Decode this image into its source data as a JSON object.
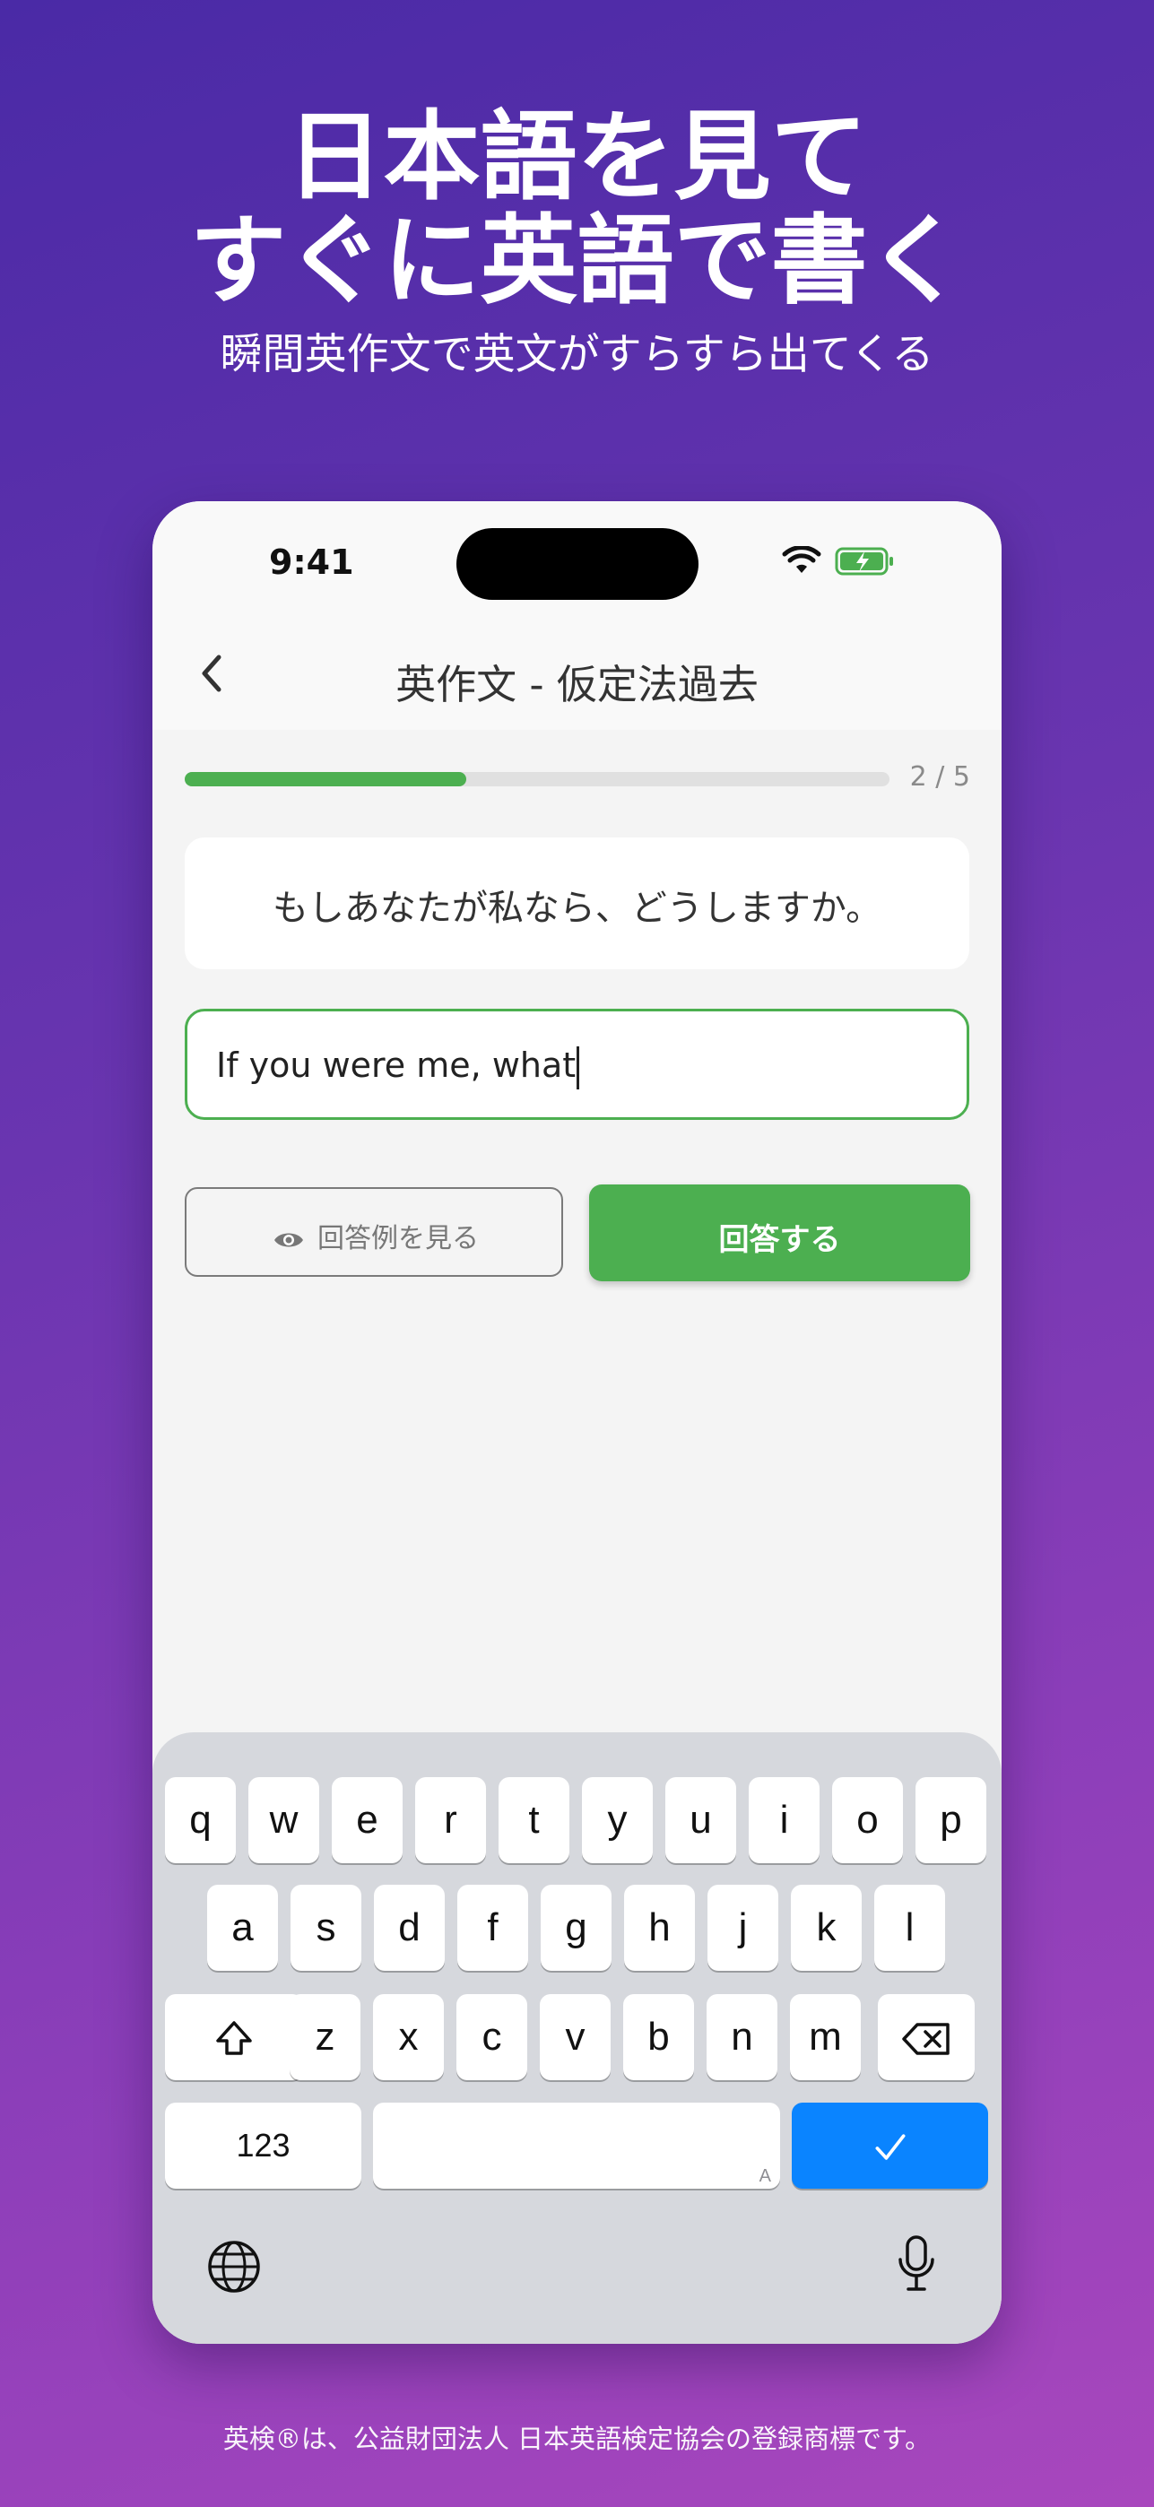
{
  "promo": {
    "headline_line1": "日本語を見て",
    "headline_line2": "すぐに英語で書く",
    "subheadline": "瞬間英作文で英文がすらすら出てくる",
    "footnote": "英検®は、公益財団法人 日本英語検定協会の登録商標です。"
  },
  "status_bar": {
    "time": "9:41",
    "icons": [
      "wifi-icon",
      "battery-charging-icon"
    ]
  },
  "nav": {
    "title": "英作文 - 仮定法過去",
    "back_icon": "chevron-left-icon"
  },
  "progress": {
    "current": 2,
    "total": 5,
    "label": "2 / 5",
    "fraction": 0.4,
    "color": "#4caf50"
  },
  "question": {
    "japanese": "もしあなたが私なら、どうしますか。"
  },
  "answer_input": {
    "value": "If you were me, what"
  },
  "buttons": {
    "show_example_label": "回答例を見る",
    "show_example_icon": "eye-icon",
    "submit_label": "回答する"
  },
  "keyboard": {
    "row1": [
      "q",
      "w",
      "e",
      "r",
      "t",
      "y",
      "u",
      "i",
      "o",
      "p"
    ],
    "row2": [
      "a",
      "s",
      "d",
      "f",
      "g",
      "h",
      "j",
      "k",
      "l"
    ],
    "row3": [
      "z",
      "x",
      "c",
      "v",
      "b",
      "n",
      "m"
    ],
    "numbers_key": "123",
    "space_hint": "A",
    "shift_icon": "shift-icon",
    "delete_icon": "delete-icon",
    "done_icon": "checkmark-icon",
    "globe_icon": "globe-icon",
    "mic_icon": "microphone-icon",
    "done_color": "#0a84ff"
  }
}
